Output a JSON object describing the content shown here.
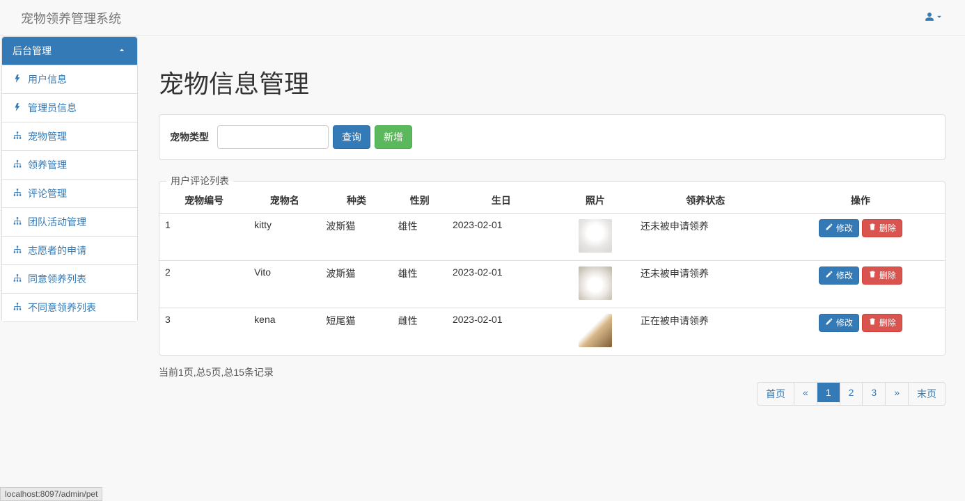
{
  "navbar": {
    "brand": "宠物领养管理系统"
  },
  "sidebar": {
    "heading": "后台管理",
    "items": [
      {
        "label": "用户信息",
        "icon": "flash"
      },
      {
        "label": "管理员信息",
        "icon": "flash"
      },
      {
        "label": "宠物管理",
        "icon": "sitemap"
      },
      {
        "label": "领养管理",
        "icon": "sitemap"
      },
      {
        "label": "评论管理",
        "icon": "sitemap"
      },
      {
        "label": "团队活动管理",
        "icon": "sitemap"
      },
      {
        "label": "志愿者的申请",
        "icon": "sitemap"
      },
      {
        "label": "同意领养列表",
        "icon": "sitemap"
      },
      {
        "label": "不同意领养列表",
        "icon": "sitemap"
      }
    ]
  },
  "page": {
    "title": "宠物信息管理"
  },
  "search": {
    "label": "宠物类型",
    "value": "",
    "query_btn": "查询",
    "add_btn": "新增"
  },
  "table": {
    "legend": "用户评论列表",
    "headers": [
      "宠物编号",
      "宠物名",
      "种类",
      "性别",
      "生日",
      "照片",
      "领养状态",
      "操作"
    ],
    "edit_label": "修改",
    "delete_label": "删除",
    "rows": [
      {
        "id": "1",
        "name": "kitty",
        "breed": "波斯猫",
        "gender": "雄性",
        "birthday": "2023-02-01",
        "status": "还未被申请领养",
        "photo_class": "p1"
      },
      {
        "id": "2",
        "name": "Vito",
        "breed": "波斯猫",
        "gender": "雄性",
        "birthday": "2023-02-01",
        "status": "还未被申请领养",
        "photo_class": "p2"
      },
      {
        "id": "3",
        "name": "kena",
        "breed": "短尾猫",
        "gender": "雌性",
        "birthday": "2023-02-01",
        "status": "正在被申请领养",
        "photo_class": "p3"
      }
    ]
  },
  "pagination": {
    "info": "当前1页,总5页,总15条记录",
    "first": "首页",
    "prev": "«",
    "pages": [
      "1",
      "2",
      "3"
    ],
    "active_index": 0,
    "next": "»",
    "last": "末页"
  },
  "statusbar": "localhost:8097/admin/pet"
}
